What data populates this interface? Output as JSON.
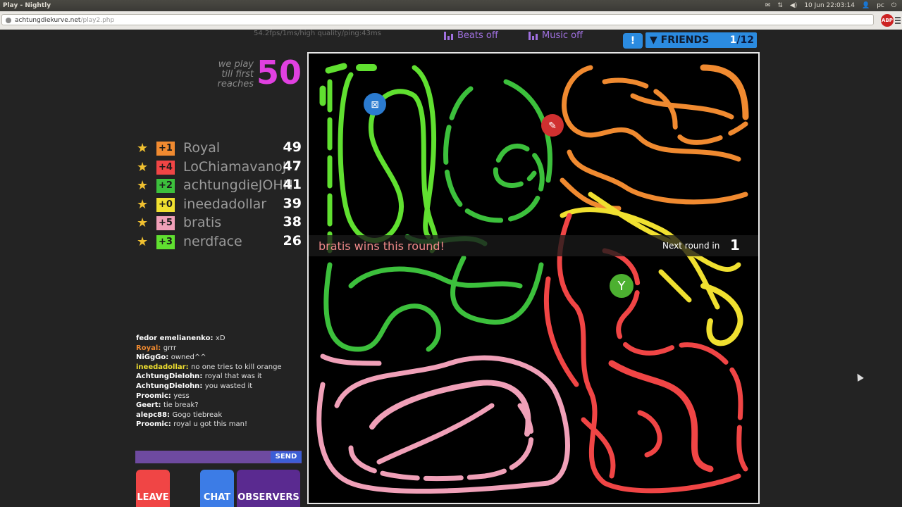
{
  "os_bar": {
    "window_title": "Play - Nightly",
    "datetime": "10 Jun 22:03:14",
    "user": "pc"
  },
  "browser": {
    "url_domain": "achtungdiekurve.net",
    "url_path": "/play2.php",
    "addon_badge": "ABP"
  },
  "game_stats": "54.2fps/1ms/high quality/ping:43ms",
  "audio": {
    "beats_label": "Beats off",
    "music_label": "Music off"
  },
  "friends": {
    "alert": "!",
    "label": "FRIENDS",
    "online": "1",
    "total": "/12"
  },
  "goal": {
    "line1": "we play",
    "line2": "till first",
    "line3": "reaches",
    "target": "50"
  },
  "scoreboard": [
    {
      "delta": "+1",
      "name": "Royal",
      "score": "49",
      "color": "#f08a30"
    },
    {
      "delta": "+4",
      "name": "LoChiamavanoJ",
      "score": "47",
      "color": "#f04545"
    },
    {
      "delta": "+2",
      "name": "achtungdieJOHN",
      "score": "41",
      "color": "#3cc03c"
    },
    {
      "delta": "+0",
      "name": "ineedadollar",
      "score": "39",
      "color": "#f0e030"
    },
    {
      "delta": "+5",
      "name": "bratis",
      "score": "38",
      "color": "#f0a0b8"
    },
    {
      "delta": "+3",
      "name": "nerdface",
      "score": "26",
      "color": "#60e030"
    }
  ],
  "chat": [
    {
      "user": "fedor emelianenko",
      "msg": "xD",
      "color": "#ffffff"
    },
    {
      "user": "Royal",
      "msg": "grrr",
      "color": "#f08a30"
    },
    {
      "user": "NiGgGo",
      "msg": "owned^^",
      "color": "#ffffff"
    },
    {
      "user": "ineedadollar",
      "msg": "no one tries to kill orange",
      "color": "#f0e030"
    },
    {
      "user": "AchtungDieIohn",
      "msg": "royal that was it",
      "color": "#ffffff"
    },
    {
      "user": "AchtungDieIohn",
      "msg": "you wasted it",
      "color": "#ffffff"
    },
    {
      "user": "Proomic",
      "msg": "yess",
      "color": "#ffffff"
    },
    {
      "user": "Geert",
      "msg": "tie break?",
      "color": "#ffffff"
    },
    {
      "user": "alepc88",
      "msg": "Gogo tiebreak",
      "color": "#ffffff"
    },
    {
      "user": "Proomic",
      "msg": "royal u got this man!",
      "color": "#ffffff"
    }
  ],
  "chat_send": "SEND",
  "buttons": {
    "leave": "LEAVE",
    "chat": "CHAT",
    "observers": "OBSERVERS"
  },
  "round": {
    "winner_message": "bratis wins this round!",
    "next_label": "Next round in",
    "countdown": "1"
  },
  "colors": {
    "orange": "#f08a30",
    "red": "#f04545",
    "green": "#3cc03c",
    "yellow": "#f0e030",
    "pink": "#f0a0b8",
    "lime": "#60e030",
    "accent": "#e040e0",
    "friends_blue": "#2b8be0"
  }
}
